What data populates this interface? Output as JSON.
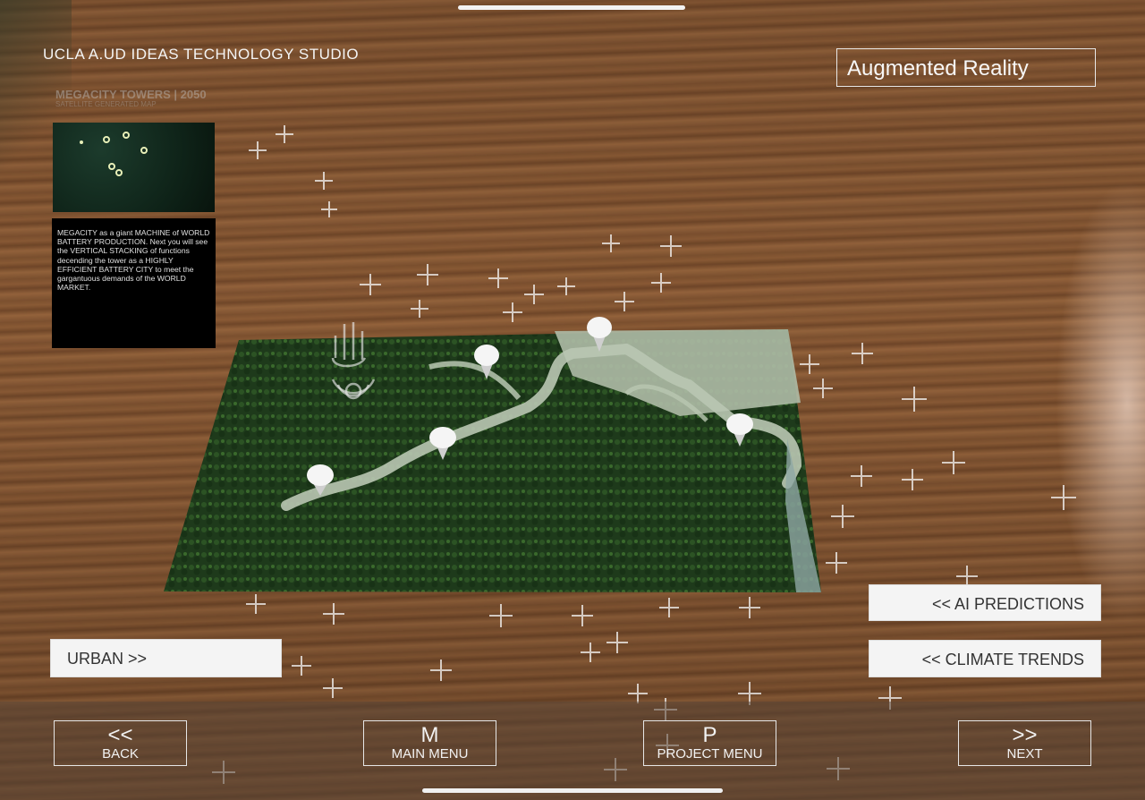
{
  "header": {
    "studio_title": "UCLA A.UD IDEAS TECHNOLOGY STUDIO",
    "mode_label": "Augmented Reality",
    "faded_title": "MEGACITY TOWERS | 2050",
    "faded_subtitle": "SATELLITE GENERATED MAP"
  },
  "info_panel": {
    "text": "MEGACITY as a giant MACHINE of WORLD BATTERY PRODUCTION. Next you will see the VERTICAL STACKING of functions decending the tower as a HIGHLY EFFICIENT BATTERY CITY to meet the gargantuous demands of the WORLD MARKET."
  },
  "side_buttons": {
    "urban": "URBAN  >>",
    "ai_predictions": "<<   AI PREDICTIONS",
    "climate_trends": "<<  CLIMATE TRENDS"
  },
  "nav": {
    "back_symbol": "<<",
    "back_label": "BACK",
    "main_symbol": "M",
    "main_label": "MAIN MENU",
    "project_symbol": "P",
    "project_label": "PROJECT MENU",
    "next_symbol": ">>",
    "next_label": "NEXT"
  },
  "icons": [
    "tap-gesture-icon",
    "map-pin-icon",
    "ar-plane-plus-marker"
  ],
  "colors": {
    "wood": "#7b4f2e",
    "button_bg": "#f4f4f4",
    "panel_bg": "#000000",
    "map_green": "#1f3a1c",
    "river": "#b9c7b2"
  }
}
